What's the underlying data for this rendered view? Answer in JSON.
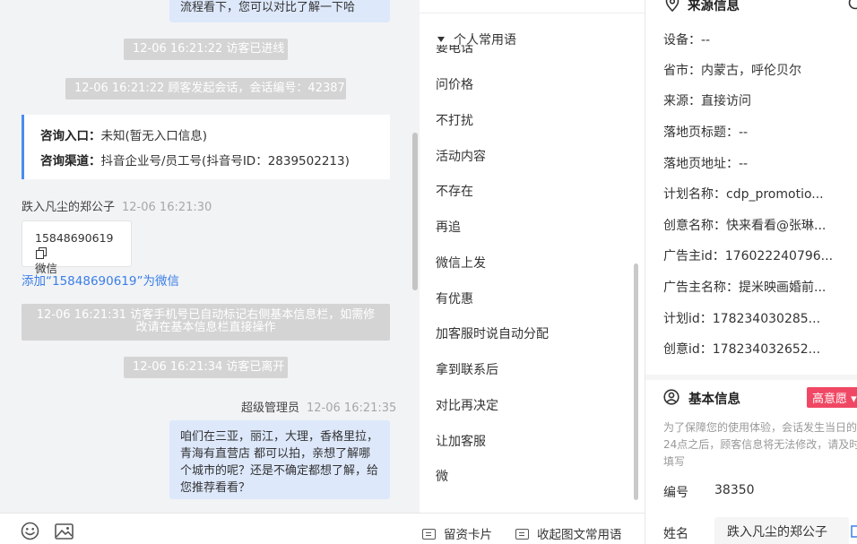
{
  "chat": {
    "top_message_partial": "流程看下，您可以对比了解一下哈",
    "sys_visitor_in": "12-06 16:21:22 访客已进线",
    "sys_session_start": "12-06 16:21:22 顾客发起会话，会话编号：42387",
    "entry_card": {
      "entry_label": "咨询入口：",
      "entry_value": "未知(暂无入口信息)",
      "channel_label": "咨询渠道：",
      "channel_value": "抖音企业号/员工号(抖音号ID：2839502213)"
    },
    "customer_name": "跌入凡尘的郑公子",
    "customer_time": "12-06 16:21:30",
    "phone_card": {
      "number": "15848690619",
      "type": "微信"
    },
    "add_wechat_link": "添加“15848690619”为微信",
    "sys_auto_mark": "12-06 16:21:31 访客手机号已自动标记右侧基本信息栏，如需修改请在基本信息栏直接操作",
    "sys_visitor_left": "12-06 16:21:34 访客已离开",
    "agent_name": "超级管理员",
    "agent_time": "12-06 16:21:35",
    "agent_message": "咱们在三亚，丽江，大理，香格里拉，青海有直营店 都可以拍，亲想了解哪个城市的呢？还是不确定都想了解，给您推荐看看？",
    "toolbar": {
      "emoji_icon": "smile-icon",
      "image_icon": "image-icon"
    }
  },
  "phrases": {
    "header": "个人常用语",
    "clipped_item": "要电话",
    "items": [
      "问价格",
      "不打扰",
      "活动内容",
      "不存在",
      "再追",
      "微信上发",
      "有优惠",
      "加客服时说自动分配",
      "拿到联系后",
      "对比再决定",
      "让加客服",
      "微"
    ],
    "footer": {
      "left_button": "留资卡片",
      "right_button": "收起图文常用语"
    }
  },
  "info": {
    "source_title": "来源信息",
    "source_rows": [
      "设备：--",
      "省市：内蒙古，呼伦贝尔",
      "来源：直接访问",
      "落地页标题：--",
      "落地页地址：--",
      "计划名称：cdp_promotio...",
      "创意名称：快来看看@张琳...",
      "广告主id：176022240796...",
      "广告主名称：提米映画婚前...",
      "计划id：178234030285...",
      "创意id：178234032652..."
    ],
    "basic_title": "基本信息",
    "intent_tag": "高意愿",
    "notice": "为了保障您的使用体验，会话发生当日的24点之后，顾客信息将无法修改，请及时填写",
    "id_label": "编号",
    "id_value": "38350",
    "name_label": "姓名",
    "name_value": "跌入凡尘的郑公子"
  }
}
